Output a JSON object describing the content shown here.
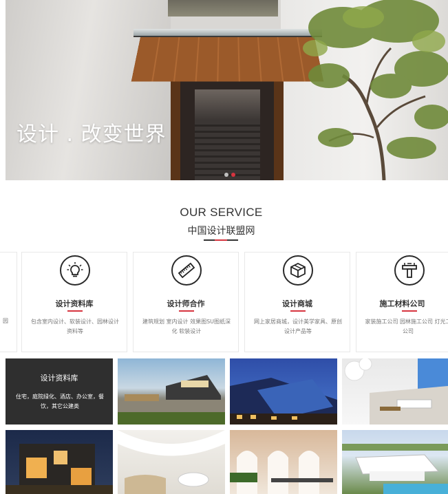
{
  "hero": {
    "slogan": "设计 . 改变世界",
    "slide_count": 2,
    "active_slide": 1
  },
  "service": {
    "title": "OUR SERVICE",
    "subtitle": "中国设计联盟网",
    "partial_left_text": "园",
    "cards": [
      {
        "title": "设计资料库",
        "desc": "包含室内设计、软装设计、园林设计资料等",
        "icon": "lightbulb-icon"
      },
      {
        "title": "设计师合作",
        "desc": "建筑规划 室内设计 效果图SU图纸深化 软装设计",
        "icon": "ruler-icon"
      },
      {
        "title": "设计商城",
        "desc": "网上家居商城，设计美学家具、原创设计产品等",
        "icon": "box-icon"
      },
      {
        "title": "施工材料公司",
        "desc": "家装施工公司 园林施工公司 灯光工公司",
        "icon": "construction-icon"
      }
    ]
  },
  "gallery": {
    "feature_tile": {
      "title": "设计资料库",
      "desc": "住宅，庭院绿化、酒店、办公室，餐饮，其它公建类"
    }
  },
  "colors": {
    "accent": "#d6343f",
    "dark_tile": "#2f2f2f"
  }
}
